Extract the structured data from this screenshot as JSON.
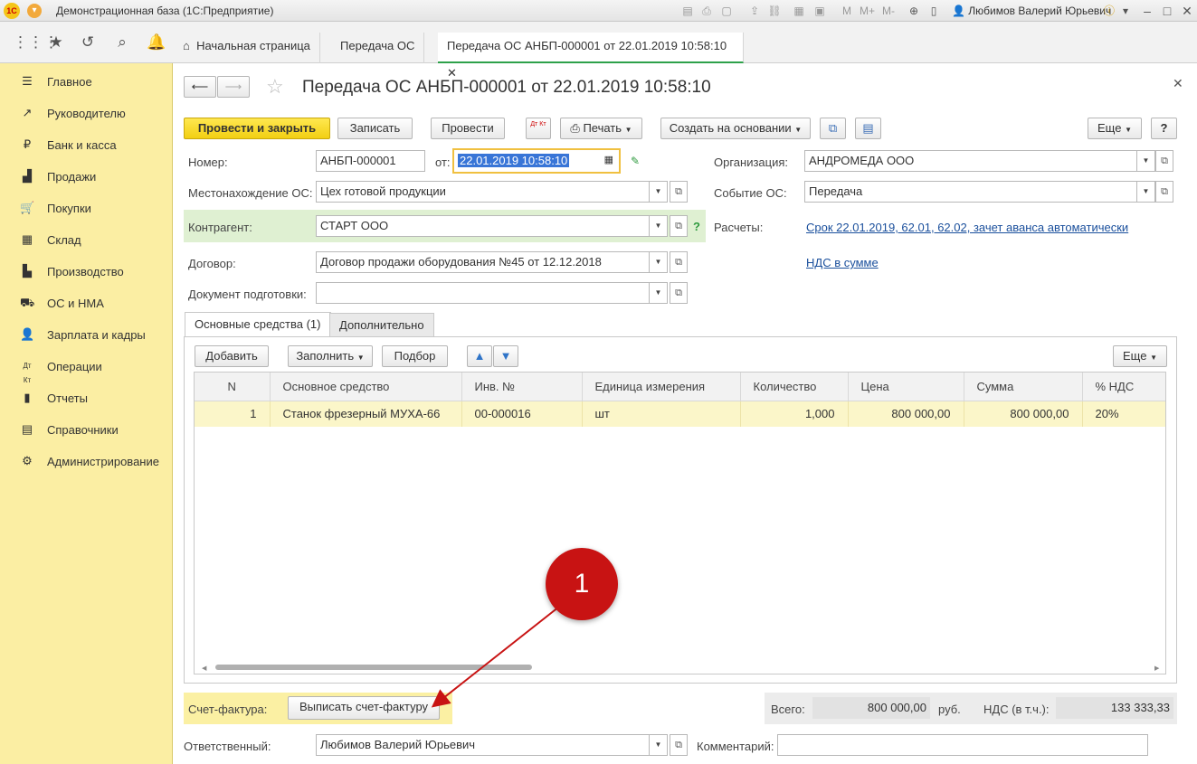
{
  "window": {
    "logo": "1С",
    "title": "Демонстрационная база  (1С:Предприятие)",
    "user": "Любимов Валерий Юрьевич",
    "toolbar_mem": [
      "M",
      "M+",
      "M-"
    ]
  },
  "nav": {
    "tabs": [
      {
        "label": "Начальная страница"
      },
      {
        "label": "Передача ОС"
      },
      {
        "label": "Передача ОС АНБП-000001 от 22.01.2019 10:58:10"
      }
    ]
  },
  "sidebar": {
    "items": [
      {
        "label": "Главное",
        "icon": "menu-icon"
      },
      {
        "label": "Руководителю",
        "icon": "trend-icon"
      },
      {
        "label": "Банк и касса",
        "icon": "ruble-icon"
      },
      {
        "label": "Продажи",
        "icon": "bag-icon"
      },
      {
        "label": "Покупки",
        "icon": "cart-icon"
      },
      {
        "label": "Склад",
        "icon": "warehouse-icon"
      },
      {
        "label": "Производство",
        "icon": "factory-icon"
      },
      {
        "label": "ОС и НМА",
        "icon": "car-icon"
      },
      {
        "label": "Зарплата и кадры",
        "icon": "person-icon"
      },
      {
        "label": "Операции",
        "icon": "dt-kt-icon"
      },
      {
        "label": "Отчеты",
        "icon": "report-icon"
      },
      {
        "label": "Справочники",
        "icon": "book-icon"
      },
      {
        "label": "Администрирование",
        "icon": "gear-icon"
      }
    ]
  },
  "doc": {
    "title": "Передача ОС АНБП-000001 от 22.01.2019 10:58:10",
    "toolbar": {
      "post_close": "Провести и закрыть",
      "save": "Записать",
      "post": "Провести",
      "dtkt": "Дт Кт",
      "print": "Печать",
      "create_based": "Создать на основании",
      "more": "Еще",
      "help": "?"
    },
    "fields": {
      "number_label": "Номер:",
      "number_value": "АНБП-000001",
      "date_label": "от:",
      "date_value": "22.01.2019 10:58:10",
      "org_label": "Организация:",
      "org_value": "АНДРОМЕДА ООО",
      "location_label": "Местонахождение ОС:",
      "location_value": "Цех готовой продукции",
      "event_label": "Событие ОС:",
      "event_value": "Передача",
      "counterparty_label": "Контрагент:",
      "counterparty_value": "СТАРТ ООО",
      "counterparty_help": "?",
      "settlements_label": "Расчеты:",
      "settlements_link": "Срок 22.01.2019, 62.01, 62.02, зачет аванса автоматически",
      "contract_label": "Договор:",
      "contract_value": "Договор продажи оборудования №45 от 12.12.2018",
      "vat_link": "НДС в сумме",
      "prep_doc_label": "Документ подготовки:",
      "prep_doc_value": ""
    },
    "tabs": [
      {
        "label": "Основные средства (1)"
      },
      {
        "label": "Дополнительно"
      }
    ],
    "table_toolbar": {
      "add": "Добавить",
      "fill": "Заполнить",
      "pick": "Подбор",
      "more": "Еще"
    },
    "table": {
      "columns": [
        "N",
        "Основное средство",
        "Инв. №",
        "Единица измерения",
        "Количество",
        "Цена",
        "Сумма",
        "% НДС"
      ],
      "rows": [
        [
          "1",
          "Станок фрезерный МУХА-66",
          "00-000016",
          "шт",
          "1,000",
          "800 000,00",
          "800 000,00",
          "20%"
        ]
      ]
    },
    "footer": {
      "invoice_label": "Счет-фактура:",
      "invoice_button": "Выписать счет-фактуру",
      "total_label": "Всего:",
      "total_value": "800 000,00",
      "currency": "руб.",
      "vat_label": "НДС (в т.ч.):",
      "vat_value": "133 333,33",
      "responsible_label": "Ответственный:",
      "responsible_value": "Любимов Валерий Юрьевич",
      "comment_label": "Комментарий:",
      "comment_value": ""
    }
  },
  "annotation": {
    "number": "1",
    "color": "#c81313"
  }
}
